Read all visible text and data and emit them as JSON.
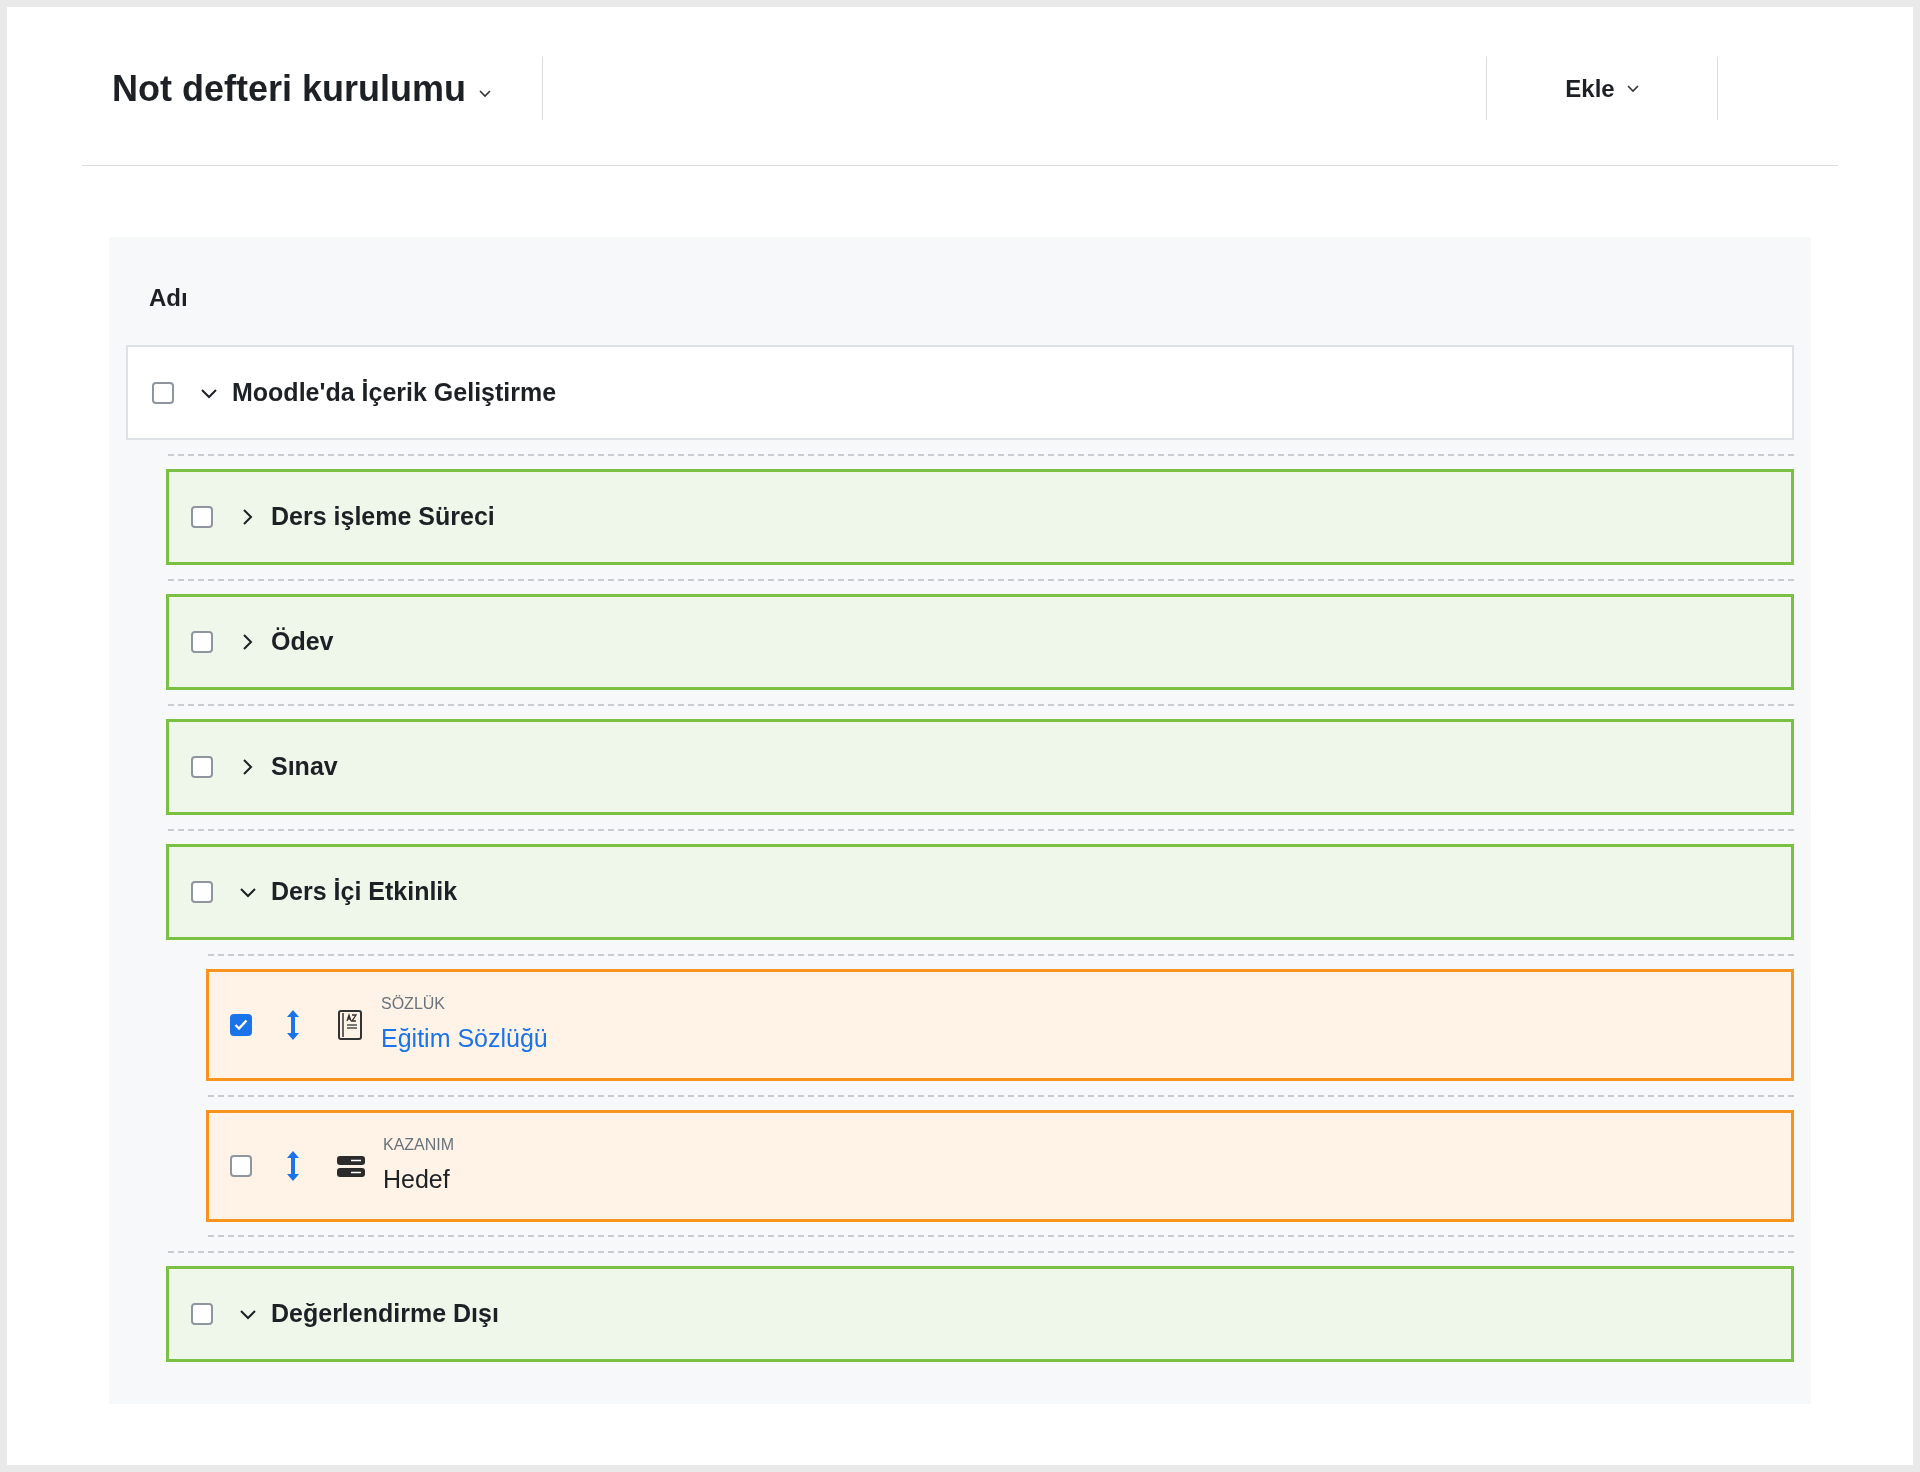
{
  "header": {
    "title": "Not defteri kurulumu",
    "add_menu": "Ekle"
  },
  "table": {
    "column_heading": "Adı",
    "tree": [
      {
        "kind": "category",
        "name": "Moodle'da İçerik Geliştirme",
        "checked": false,
        "expanded": true,
        "children": [
          {
            "kind": "category",
            "name": "Ders işleme Süreci",
            "checked": false,
            "expanded": false
          },
          {
            "kind": "category",
            "name": "Ödev",
            "checked": false,
            "expanded": false
          },
          {
            "kind": "category",
            "name": "Sınav",
            "checked": false,
            "expanded": false
          },
          {
            "kind": "category",
            "name": "Ders İçi Etkinlik",
            "checked": false,
            "expanded": true,
            "children": [
              {
                "kind": "glossary",
                "type": "SÖZLÜK",
                "name": "Eğitim Sözlüğü",
                "link": true,
                "checked": true
              },
              {
                "kind": "outcome",
                "type": "KAZANIM",
                "name": "Hedef",
                "link": false,
                "checked": false
              }
            ]
          },
          {
            "kind": "category",
            "name": "Değerlendirme Dışı",
            "checked": false,
            "expanded": true
          }
        ]
      }
    ]
  }
}
